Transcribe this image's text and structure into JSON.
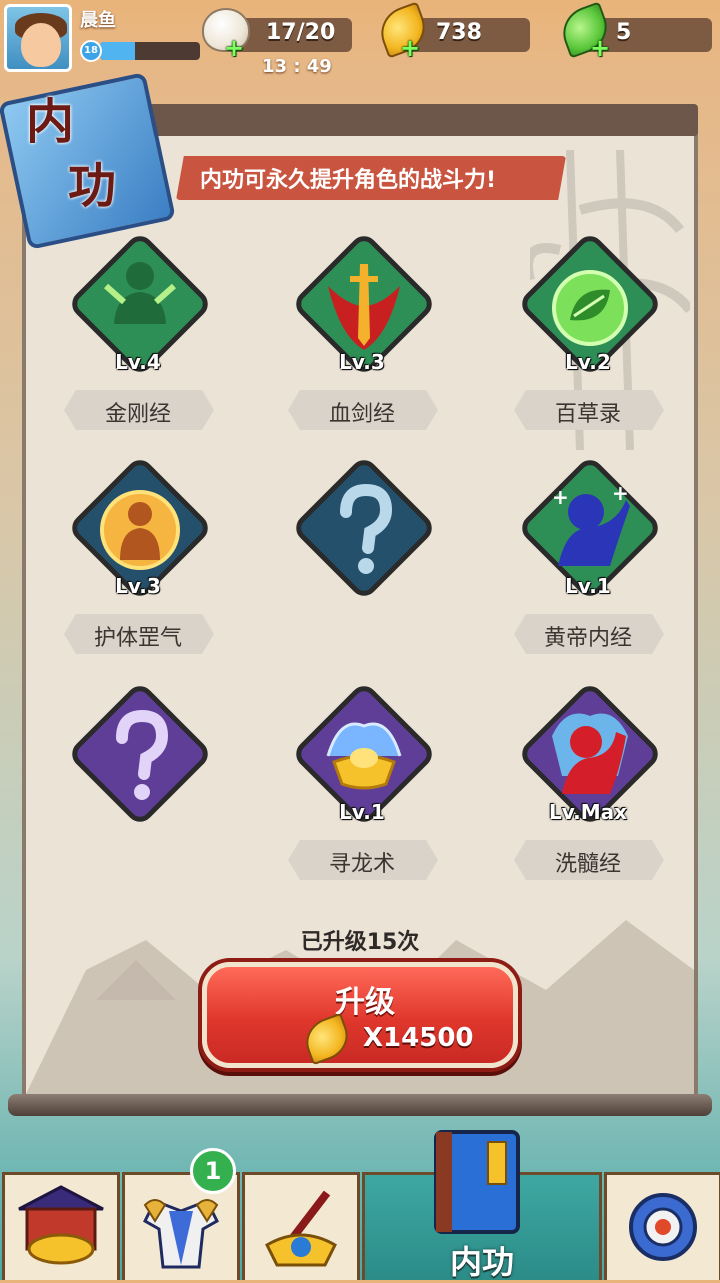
{
  "player": {
    "name": "晨鱼",
    "level": "18",
    "xp_fraction": 0.35
  },
  "resources": {
    "stamina": "17/20",
    "stamina_timer": "13 : 49",
    "gold": "738",
    "jade": "5"
  },
  "header": {
    "title_line1": "内",
    "title_line2": "功",
    "banner": "内功可永久提升角色的战斗力!"
  },
  "skills": [
    {
      "name": "金刚经",
      "level": "Lv.4"
    },
    {
      "name": "血剑经",
      "level": "Lv.3"
    },
    {
      "name": "百草录",
      "level": "Lv.2"
    },
    {
      "name": "护体罡气",
      "level": "Lv.3"
    },
    {
      "name": "",
      "level": ""
    },
    {
      "name": "黄帝内经",
      "level": "Lv.1"
    },
    {
      "name": "",
      "level": ""
    },
    {
      "name": "寻龙术",
      "level": "Lv.1"
    },
    {
      "name": "洗髓经",
      "level": "Lv.Max"
    }
  ],
  "upgrade": {
    "count_text": "已升级15次",
    "button_label": "升级",
    "cost": "X14500"
  },
  "nav": {
    "equipment_badge": "1",
    "active_label": "内功"
  }
}
